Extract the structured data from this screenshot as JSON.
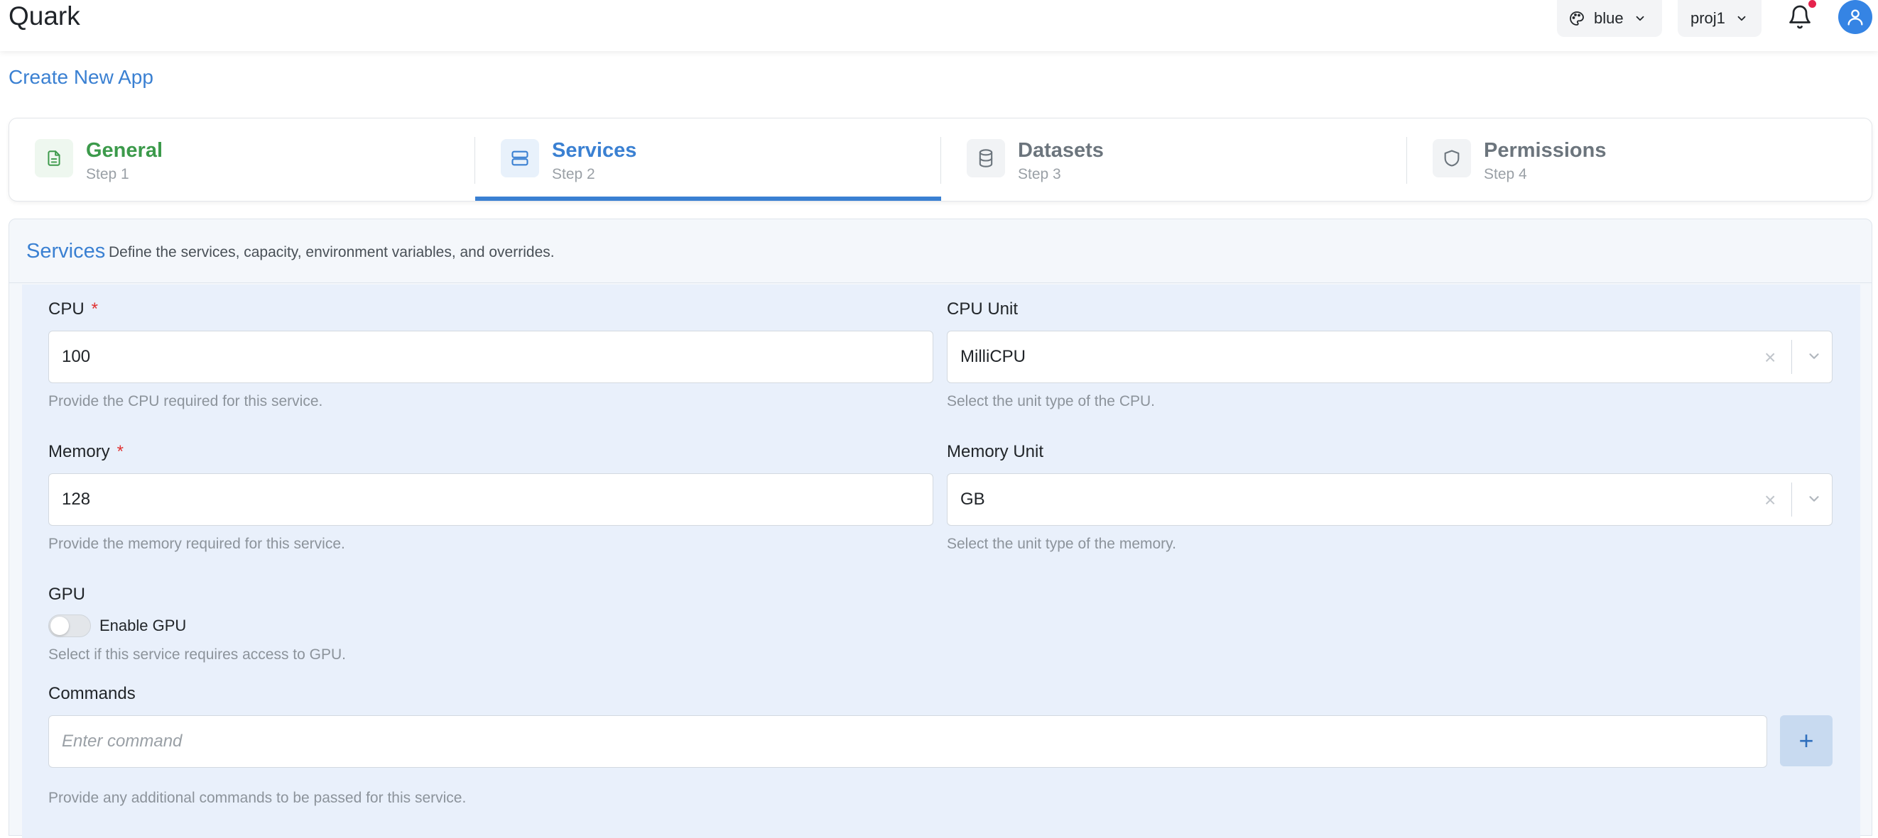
{
  "app": {
    "brand": "Quark"
  },
  "header": {
    "theme_label": "blue",
    "project_label": "proj1"
  },
  "page": {
    "title": "Create New App"
  },
  "steps": [
    {
      "name": "General",
      "sub": "Step 1",
      "state": "done",
      "icon": "document-icon"
    },
    {
      "name": "Services",
      "sub": "Step 2",
      "state": "active",
      "icon": "server-icon"
    },
    {
      "name": "Datasets",
      "sub": "Step 3",
      "state": "pending",
      "icon": "database-icon"
    },
    {
      "name": "Permissions",
      "sub": "Step 4",
      "state": "pending",
      "icon": "shield-icon"
    }
  ],
  "services": {
    "title": "Services",
    "description": "Define the services, capacity, environment variables, and overrides.",
    "cpu": {
      "label": "CPU",
      "required": "*",
      "value": "100",
      "help": "Provide the CPU required for this service."
    },
    "cpu_unit": {
      "label": "CPU Unit",
      "value": "MilliCPU",
      "help": "Select the unit type of the CPU."
    },
    "memory": {
      "label": "Memory",
      "required": "*",
      "value": "128",
      "help": "Provide the memory required for this service."
    },
    "memory_unit": {
      "label": "Memory Unit",
      "value": "GB",
      "help": "Select the unit type of the memory."
    },
    "gpu": {
      "label": "GPU",
      "toggle_label": "Enable GPU",
      "enabled": false,
      "help": "Select if this service requires access to GPU."
    },
    "commands": {
      "label": "Commands",
      "placeholder": "Enter command",
      "add_label": "+",
      "help": "Provide any additional commands to be passed for this service."
    }
  },
  "colors": {
    "accent": "#3a80d2",
    "success": "#3c9a4b",
    "required": "#e03131",
    "panel_bg": "#e9f0fb"
  }
}
